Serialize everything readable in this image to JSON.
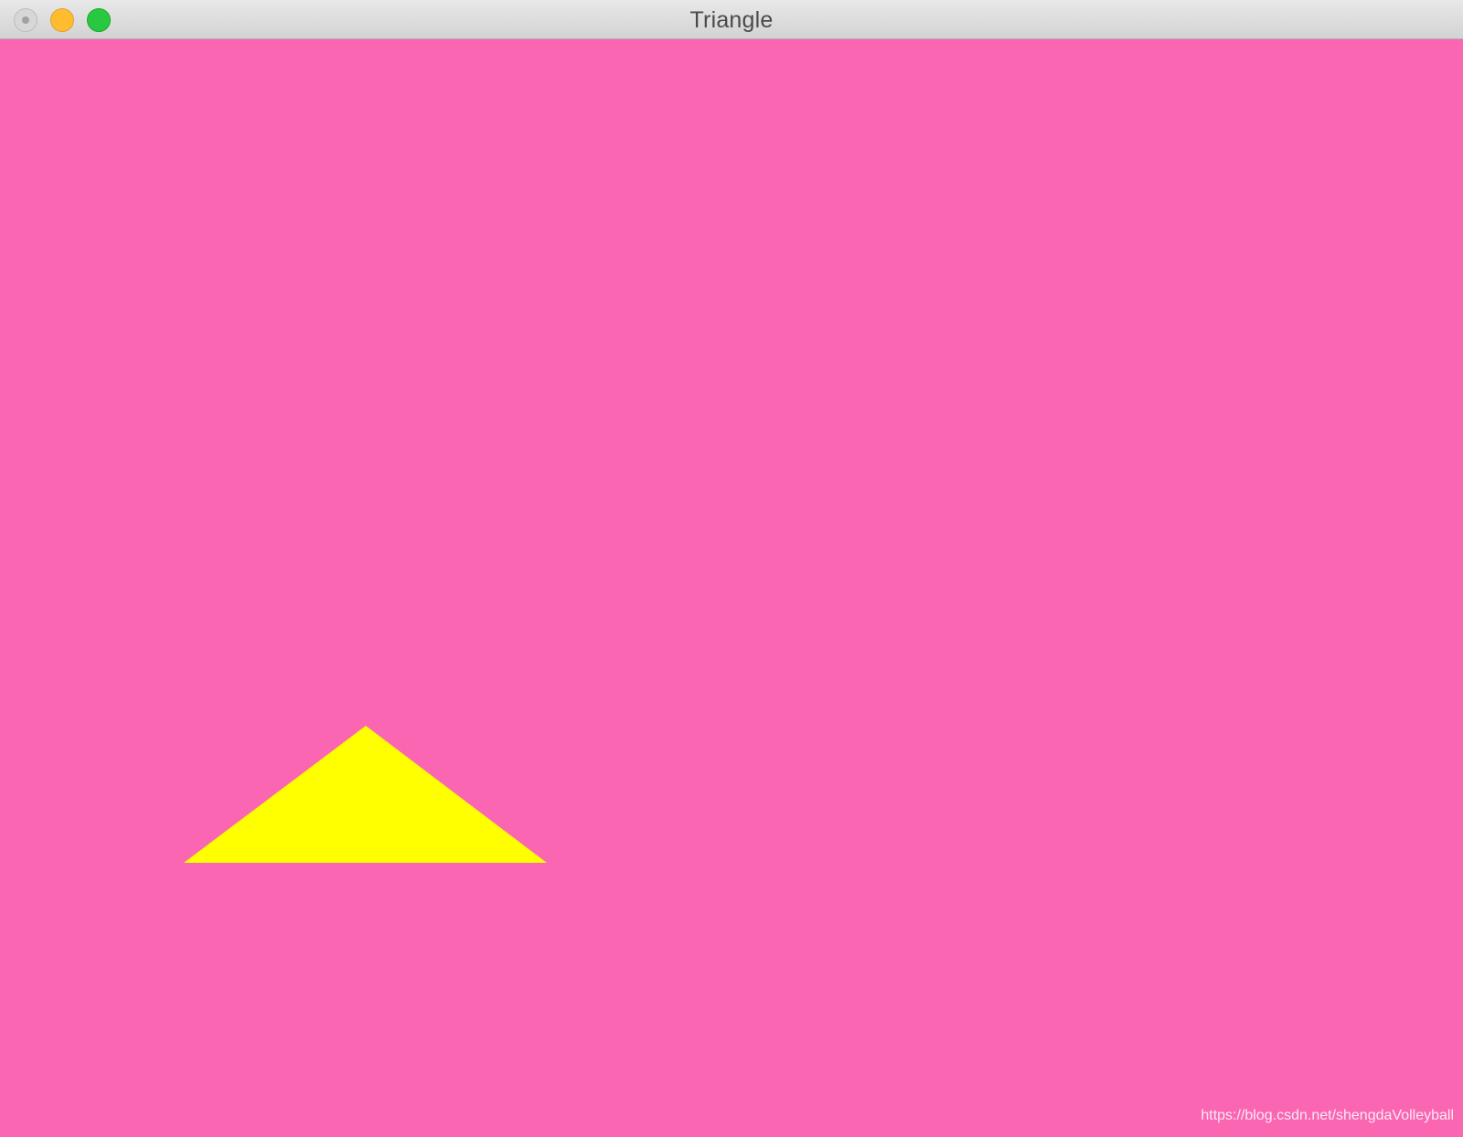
{
  "window": {
    "title": "Triangle"
  },
  "canvas": {
    "background_color": "#fa66b2",
    "shape": {
      "kind": "triangle",
      "fill_color": "#ffff00"
    }
  },
  "colors": {
    "close_button": "#d7d7d7",
    "minimize_button": "#febc2e",
    "zoom_button": "#28c840"
  },
  "watermark": {
    "text": "https://blog.csdn.net/shengdaVolleyball"
  }
}
